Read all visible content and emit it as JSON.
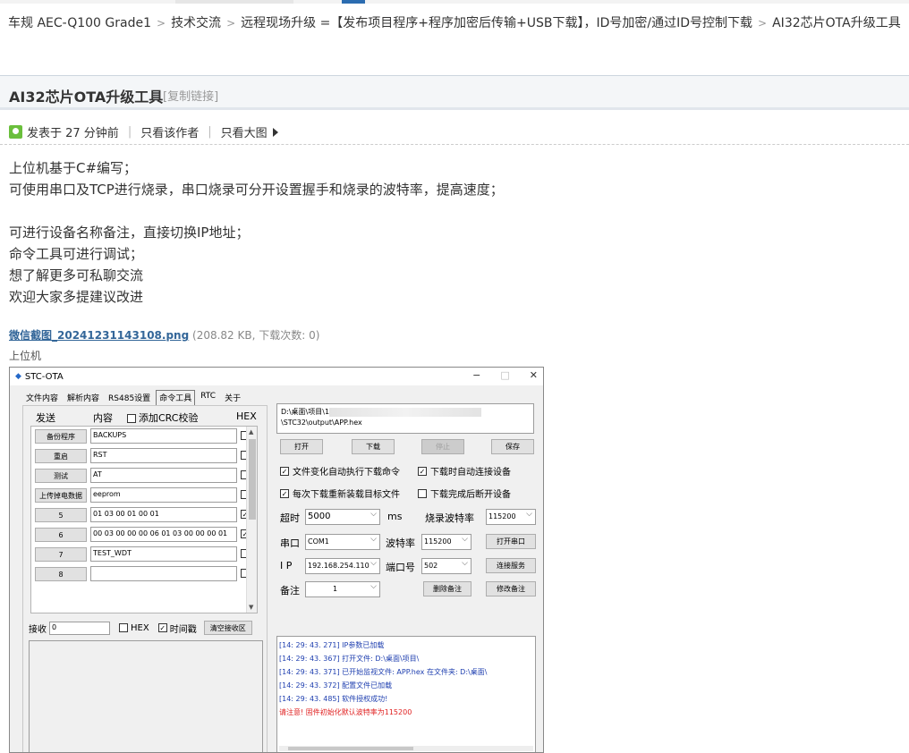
{
  "breadcrumb": [
    "车规 AEC-Q100 Grade1",
    "技术交流",
    "远程现场升级 =【发布项目程序+程序加密后传输+USB下载】，ID号加密/通过ID号控制下载",
    "AI32芯片OTA升级工具"
  ],
  "thread": {
    "title": "AI32芯片OTA升级工具",
    "copy_link": "[复制链接]",
    "posted": "发表于 27 分钟前",
    "only_author": "只看该作者",
    "only_big": "只看大图"
  },
  "content": [
    "上位机基于C#编写；",
    "可使用串口及TCP进行烧录，串口烧录可分开设置握手和烧录的波特率，提高速度；",
    "",
    "可进行设备名称备注，直接切换IP地址；",
    "命令工具可进行调试；",
    "想了解更多可私聊交流",
    "欢迎大家多提建议改进"
  ],
  "attachment": {
    "name": "微信截图_20241231143108.png",
    "info": "(208.82 KB, 下载次数: 0)",
    "caption": "上位机"
  },
  "app": {
    "title": "STC-OTA",
    "controls": [
      "−",
      "□",
      "✕"
    ],
    "tabs": [
      "文件内容",
      "解析内容",
      "RS485设置",
      "命令工具",
      "RTC",
      "关于"
    ],
    "left": {
      "header_send": "发送",
      "header_content": "内容",
      "header_crc": "添加CRC校验",
      "header_hex": "HEX",
      "rows": [
        {
          "btn": "备份程序",
          "val": "BACKUPS",
          "hex": ""
        },
        {
          "btn": "重启",
          "val": "RST",
          "hex": ""
        },
        {
          "btn": "测试",
          "val": "AT",
          "hex": ""
        },
        {
          "btn": "上传掉电数据",
          "val": "eeprom",
          "hex": ""
        },
        {
          "btn": "5",
          "val": "01 03 00 01 00 01",
          "hex": "✓"
        },
        {
          "btn": "6",
          "val": "00 03 00 00 00 06 01 03 00 00  00 01",
          "hex": "✓"
        },
        {
          "btn": "7",
          "val": "TEST_WDT",
          "hex": ""
        },
        {
          "btn": "8",
          "val": "",
          "hex": ""
        }
      ],
      "recv_label": "接收",
      "recv_value": "0",
      "hex_label": "HEX",
      "timestamp_label": "时间戳",
      "timestamp_check": "✓",
      "clear_btn": "清空接收区"
    },
    "right": {
      "path_line1": "D:\\桌面\\项目\\1",
      "path_line2": "\\STC32\\output\\APP.hex",
      "btn_open": "打开",
      "btn_download": "下载",
      "btn_stop": "停止",
      "btn_save": "保存",
      "opt1": "文件变化自动执行下载命令",
      "opt2": "下载时自动连接设备",
      "opt3": "每次下载重新装载目标文件",
      "opt4": "下载完成后断开设备",
      "check": "✓",
      "timeout_label": "超时",
      "timeout_value": "5000",
      "ms": "ms",
      "burn_baud_label": "烧录波特率",
      "burn_baud_value": "115200",
      "port_label": "串口",
      "port_value": "COM1",
      "baud_label": "波特率",
      "baud_value": "115200",
      "open_port_btn": "打开串口",
      "ip_label": "I  P",
      "ip_value": "192.168.254.110",
      "port_no_label": "端口号",
      "port_no_value": "502",
      "connect_btn": "连接服务",
      "note_label": "备注",
      "note_value": "1",
      "del_note_btn": "删除备注",
      "edit_note_btn": "修改备注",
      "log": [
        {
          "text": "[14: 29: 43. 271] IP参数已加载",
          "red": false
        },
        {
          "text": "[14: 29: 43. 367] 打开文件: D:\\桌面\\项目\\",
          "red": false
        },
        {
          "text": "[14: 29: 43. 371] 已开始监视文件: APP.hex 在文件夹: D:\\桌面\\",
          "red": false
        },
        {
          "text": "[14: 29: 43. 372] 配置文件已加载",
          "red": false
        },
        {
          "text": "[14: 29: 43. 485] 软件授权成功!",
          "red": false
        },
        {
          "text": "请注意! 固件初始化默认波特率为115200",
          "red": true
        }
      ]
    }
  }
}
